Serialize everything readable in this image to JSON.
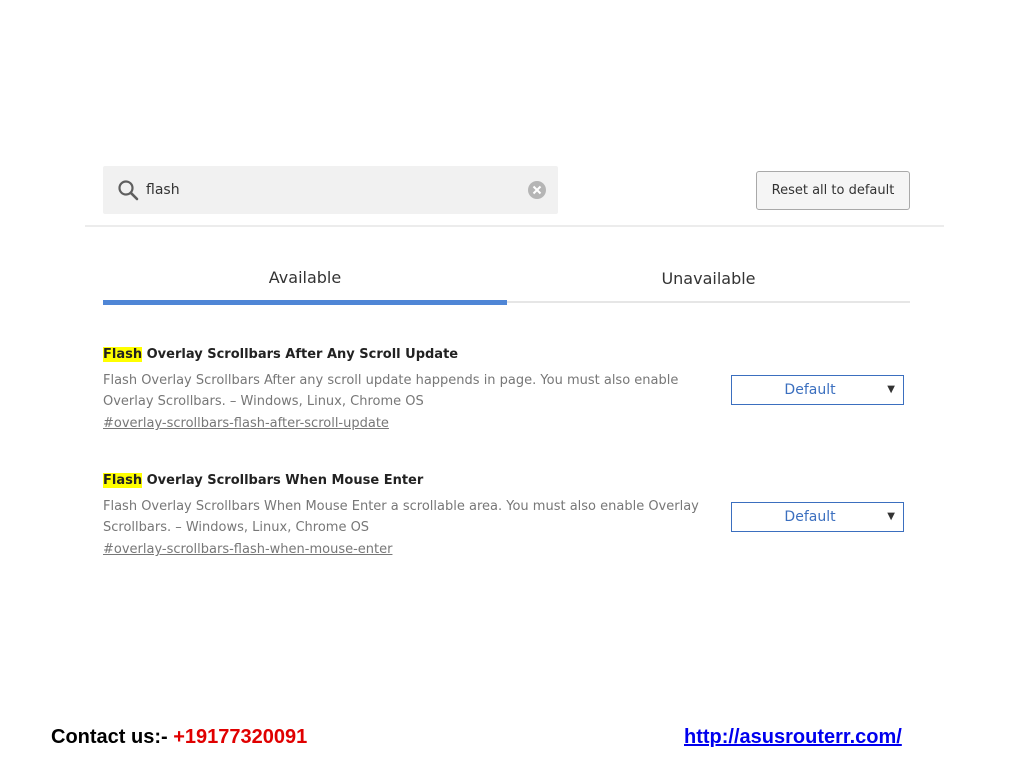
{
  "search": {
    "value": "flash",
    "icon": "search-icon",
    "clear_icon": "clear-icon"
  },
  "toolbar": {
    "reset_label": "Reset all to default"
  },
  "tabs": [
    {
      "label": "Available",
      "active": true
    },
    {
      "label": "Unavailable",
      "active": false
    }
  ],
  "experiments": [
    {
      "title_highlight": "Flash",
      "title_rest": " Overlay Scrollbars After Any Scroll Update",
      "description": "Flash Overlay Scrollbars After any scroll update happends in page. You must also enable Overlay Scrollbars. – Windows, Linux, Chrome OS",
      "link": "#overlay-scrollbars-flash-after-scroll-update",
      "select_value": "Default"
    },
    {
      "title_highlight": "Flash",
      "title_rest": " Overlay Scrollbars When Mouse Enter",
      "description": "Flash Overlay Scrollbars When Mouse Enter a scrollable area. You must also enable Overlay Scrollbars. – Windows, Linux, Chrome OS",
      "link": "#overlay-scrollbars-flash-when-mouse-enter",
      "select_value": "Default"
    }
  ],
  "footer": {
    "contact_label": "Contact us:- ",
    "phone": "+19177320091",
    "url": "http://asusrouterr.com/"
  },
  "colors": {
    "accent": "#4f86d6",
    "highlight": "#ffff00",
    "phone": "#e00000",
    "link": "#0000ee"
  }
}
